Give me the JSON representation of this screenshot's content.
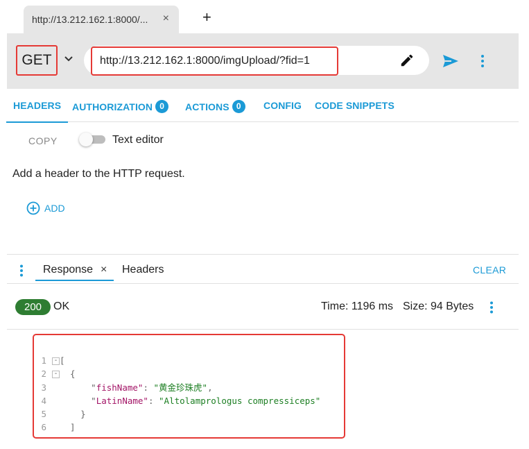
{
  "browser": {
    "tab_title": "http://13.212.162.1:8000/...",
    "tab_close": "×",
    "new_tab": "+"
  },
  "request": {
    "method": "GET",
    "url": "http://13.212.162.1:8000/imgUpload/?fid=1"
  },
  "request_tabs": [
    {
      "label": "HEADERS",
      "active": true
    },
    {
      "label": "AUTHORIZATION",
      "badge": "0"
    },
    {
      "label": "ACTIONS",
      "badge": "0"
    },
    {
      "label": "CONFIG"
    },
    {
      "label": "CODE SNIPPETS"
    }
  ],
  "headers_panel": {
    "copy_label": "COPY",
    "text_editor_label": "Text editor",
    "text_editor_on": false,
    "hint": "Add a header to the HTTP request.",
    "add_label": "ADD"
  },
  "response": {
    "tab_label": "Response",
    "tab_close": "×",
    "headers_tab_label": "Headers",
    "clear_label": "CLEAR",
    "status_code": "200",
    "status_text": "OK",
    "time": "Time: 1196 ms",
    "size": "Size: 94 Bytes",
    "body_lines": [
      {
        "n": "1",
        "text": "["
      },
      {
        "n": "2",
        "text": "  {"
      },
      {
        "n": "3",
        "key": "fishName",
        "value": "黄金珍珠虎"
      },
      {
        "n": "4",
        "key": "LatinName",
        "value": "Altolamprologus compressiceps"
      },
      {
        "n": "5",
        "text": "    }"
      },
      {
        "n": "6",
        "text": "  ]"
      }
    ]
  },
  "colors": {
    "accent": "#1b9ad6",
    "highlight": "#e53935",
    "status_ok": "#2e7d32",
    "json_key": "#a31466",
    "json_string": "#1d7f23"
  }
}
